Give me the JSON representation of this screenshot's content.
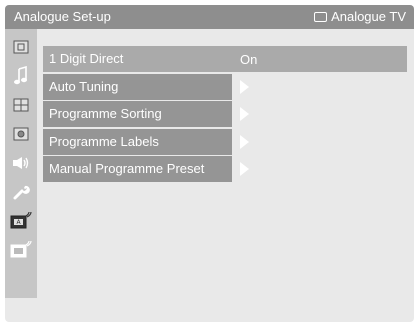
{
  "header": {
    "title": "Analogue Set-up",
    "source_label": "Analogue TV"
  },
  "sidebar": {
    "icons": [
      {
        "name": "picture-icon"
      },
      {
        "name": "sound-icon"
      },
      {
        "name": "features-icon"
      },
      {
        "name": "settings-icon"
      },
      {
        "name": "speaker-icon"
      },
      {
        "name": "wrench-icon"
      },
      {
        "name": "analogue-setup-icon"
      },
      {
        "name": "digital-setup-icon"
      }
    ]
  },
  "menu": {
    "items": [
      {
        "label": "1 Digit Direct",
        "value": "On"
      },
      {
        "label": "Auto Tuning"
      },
      {
        "label": "Programme Sorting"
      },
      {
        "label": "Programme Labels"
      },
      {
        "label": "Manual Programme Preset"
      }
    ]
  },
  "colors": {
    "titlebar": "#8e8e8e",
    "menu_item": "#959595",
    "menu_selected": "#aaaaaa",
    "background": "#e9e9e9"
  }
}
